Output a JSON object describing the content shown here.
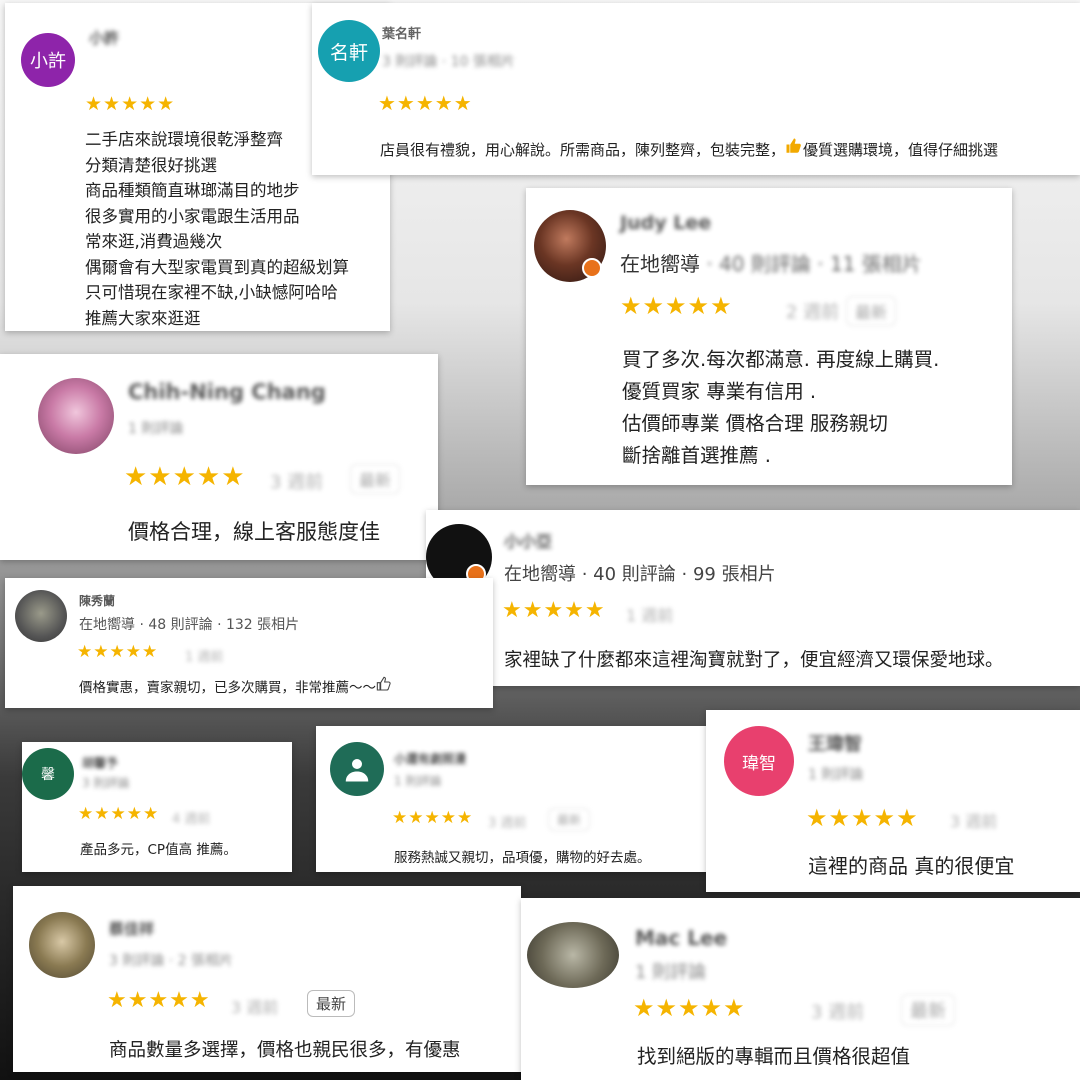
{
  "reviews": [
    {
      "id": "r1",
      "name": "小許",
      "meta": "",
      "avatar_text": "小許",
      "avatar_color": "#8e24aa",
      "stars": "★★★★★",
      "when": "",
      "lines": "二手店來說環境很乾淨整齊\n分類清楚很好挑選\n商品種類簡直琳瑯滿目的地步\n很多實用的小家電跟生活用品\n常來逛,消費過幾次\n偶爾會有大型家電買到真的超級划算\n只可惜現在家裡不缺,小缺憾阿哈哈\n推薦大家來逛逛"
    },
    {
      "id": "r2",
      "name": "葉名軒",
      "meta": "3 則評論 · 10 張相片",
      "avatar_text": "名軒",
      "avatar_color": "#16a0b0",
      "stars": "★★★★★",
      "when": "",
      "text": "店員很有禮貌，用心解說。所需商品，陳列整齊，包裝完整，",
      "text2": "優質選購環境，值得仔細挑選"
    },
    {
      "id": "r3",
      "name": "Judy Lee",
      "meta": "在地嚮導",
      "meta_blurred": "· 40 則評論 · 11 張相片",
      "stars": "★★★★★",
      "when": "2 週前",
      "pill": "最新",
      "lines": "買了多次.每次都滿意. 再度線上購買.\n優質買家 專業有信用 .\n估價師專業 價格合理 服務親切\n斷捨離首選推薦 ."
    },
    {
      "id": "r4",
      "name": "Chih-Ning Chang",
      "meta": "1 則評論",
      "stars": "★★★★★",
      "when": "3 週前",
      "pill": "最新",
      "text": "價格合理，線上客服態度佳"
    },
    {
      "id": "r5",
      "name": "小小亞",
      "meta": "在地嚮導 · 40 則評論 · 99 張相片",
      "stars": "★★★★★",
      "when": "1 週前",
      "text": "家裡缺了什麼都來這裡淘寶就對了，便宜經濟又環保愛地球。"
    },
    {
      "id": "r6",
      "name": "陳秀蘭",
      "meta": "在地嚮導 · 48 則評論 · 132 張相片",
      "stars": "★★★★★",
      "when": "1 週前",
      "text": "價格實惠，賣家親切，已多次購買，非常推薦～～"
    },
    {
      "id": "r7",
      "name": "胡馨予",
      "meta": "3 則評論",
      "avatar_text": "馨",
      "avatar_color": "#1b6b4a",
      "stars": "★★★★★",
      "when": "4 週前",
      "text": "產品多元，CP值高 推薦。"
    },
    {
      "id": "r8",
      "name": "小還有劇照漫",
      "meta": "1 則評論",
      "stars": "★★★★★",
      "when": "3 週前",
      "pill": "最新",
      "text": "服務熱誠又親切，品項優，購物的好去處。"
    },
    {
      "id": "r9",
      "name": "王瑋智",
      "meta": "1 則評論",
      "avatar_text": "瑋智",
      "avatar_color": "#e8406e",
      "stars": "★★★★★",
      "when": "3 週前",
      "text": "這裡的商品 真的很便宜"
    },
    {
      "id": "r10",
      "name": "蔡佳祥",
      "meta": "3 則評論 · 2 張相片",
      "stars": "★★★★★",
      "when": "3 週前",
      "pill": "最新",
      "text": "商品數量多選擇，價格也親民很多，有優惠"
    },
    {
      "id": "r11",
      "name": "Mac Lee",
      "meta": "1 則評論",
      "stars": "★★★★★",
      "when": "3 週前",
      "pill": "最新",
      "text": "找到絕版的專輯而且價格很超值"
    }
  ],
  "icons": {
    "thumbs_up": "thumbs-up-icon",
    "local_guide": "local-guide-badge-icon"
  },
  "colors": {
    "star": "#f5b400",
    "guide_badge": "#e8711a"
  }
}
